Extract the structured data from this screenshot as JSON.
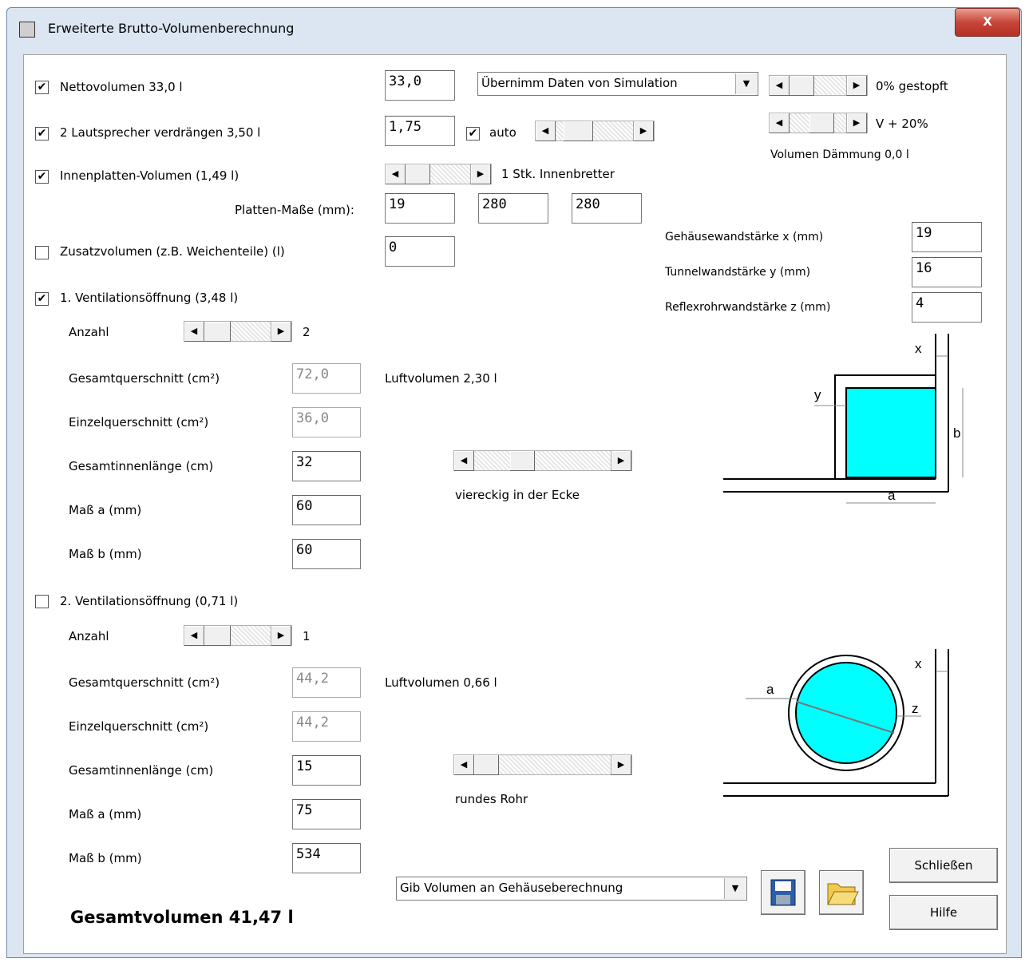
{
  "window": {
    "title": "Erweiterte Brutto-Volumenberechnung",
    "close": "X"
  },
  "row1": {
    "label": "Nettovolumen 33,0 l",
    "value": "33,0",
    "dropdown": "Übernimm Daten von Simulation",
    "stuffing": "0% gestopft"
  },
  "row2": {
    "label": "2 Lautsprecher verdrängen 3,50 l",
    "value": "1,75",
    "auto_label": "auto",
    "v_label": "V + 20%",
    "insulation": "Volumen Dämmung 0,0 l"
  },
  "row3": {
    "label": "Innenplatten-Volumen (1,49 l)",
    "count": "1 Stk. Innenbretter"
  },
  "plates": {
    "label": "Platten-Maße (mm):",
    "v1": "19",
    "v2": "280",
    "v3": "280"
  },
  "row4": {
    "label": "Zusatzvolumen (z.B. Weichenteile) (l)",
    "value": "0"
  },
  "walls": {
    "x_label": "Gehäusewandstärke x (mm)",
    "x_value": "19",
    "y_label": "Tunnelwandstärke y (mm)",
    "y_value": "16",
    "z_label": "Reflexrohrwandstärke z (mm)",
    "z_value": "4"
  },
  "vent1": {
    "label": "1. Ventilationsöffnung (3,48 l)",
    "anzahl_label": "Anzahl",
    "anzahl": "2",
    "gq_label": "Gesamtquerschnitt (cm²)",
    "gq": "72,0",
    "eq_label": "Einzelquerschnitt (cm²)",
    "eq": "36,0",
    "gl_label": "Gesamtinnenlänge (cm)",
    "gl": "32",
    "a_label": "Maß a (mm)",
    "a": "60",
    "b_label": "Maß b (mm)",
    "b": "60",
    "air": "Luftvolumen 2,30 l",
    "shape": "viereckig in der Ecke"
  },
  "vent2": {
    "label": "2. Ventilationsöffnung (0,71 l)",
    "anzahl_label": "Anzahl",
    "anzahl": "1",
    "gq_label": "Gesamtquerschnitt (cm²)",
    "gq": "44,2",
    "eq_label": "Einzelquerschnitt (cm²)",
    "eq": "44,2",
    "gl_label": "Gesamtinnenlänge (cm)",
    "gl": "15",
    "a_label": "Maß a (mm)",
    "a": "75",
    "b_label": "Maß b (mm)",
    "b": "534",
    "air": "Luftvolumen 0,66 l",
    "shape": "rundes Rohr"
  },
  "diagram": {
    "x": "x",
    "y": "y",
    "a": "a",
    "b": "b",
    "z": "z"
  },
  "footer": {
    "dropdown": "Gib Volumen an Gehäuseberechnung",
    "close": "Schließen",
    "help": "Hilfe",
    "total": "Gesamtvolumen 41,47 l"
  },
  "colors": {
    "fill": "#00ffff"
  }
}
